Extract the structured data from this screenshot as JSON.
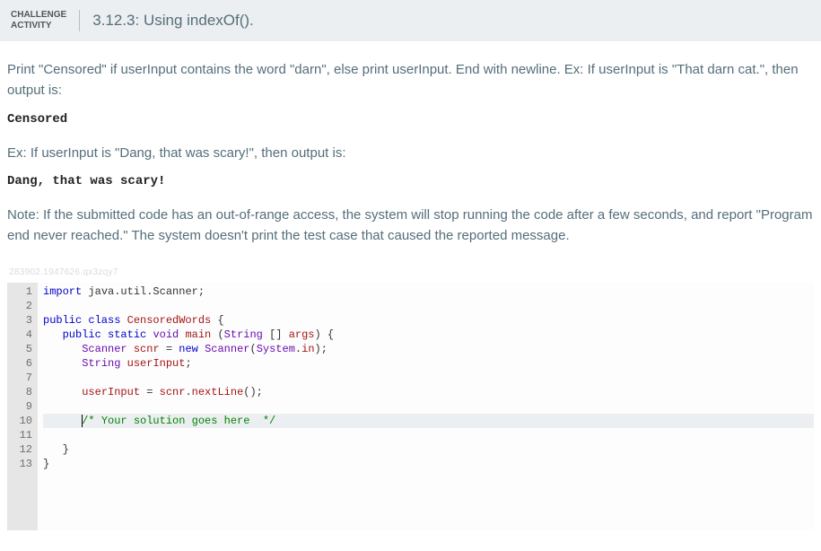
{
  "header": {
    "challenge_label_line1": "CHALLENGE",
    "challenge_label_line2": "ACTIVITY",
    "title": "3.12.3: Using indexOf()."
  },
  "description": {
    "p1": "Print \"Censored\" if userInput contains the word \"darn\", else print userInput. End with newline. Ex: If userInput is \"That darn cat.\", then output is:",
    "out1": "Censored",
    "p2": "Ex: If userInput is \"Dang, that was scary!\", then output is:",
    "out2": "Dang, that was scary!",
    "p3": "Note: If the submitted code has an out-of-range access, the system will stop running the code after a few seconds, and report \"Program end never reached.\" The system doesn't print the test case that caused the reported message."
  },
  "hash": "283902.1947626.qx3zqy7",
  "code": {
    "tokens": [
      [
        {
          "t": "import ",
          "c": "kw"
        },
        {
          "t": "java.util.Scanner;",
          "c": "pkg"
        }
      ],
      [],
      [
        {
          "t": "public class ",
          "c": "kw"
        },
        {
          "t": "CensoredWords",
          "c": "cls"
        },
        {
          "t": " {",
          "c": ""
        }
      ],
      [
        {
          "t": "   ",
          "c": ""
        },
        {
          "t": "public static ",
          "c": "kw"
        },
        {
          "t": "void",
          "c": "type"
        },
        {
          "t": " ",
          "c": ""
        },
        {
          "t": "main",
          "c": "cls"
        },
        {
          "t": " (",
          "c": ""
        },
        {
          "t": "String",
          "c": "type"
        },
        {
          "t": " [] ",
          "c": ""
        },
        {
          "t": "args",
          "c": "cls"
        },
        {
          "t": ") {",
          "c": ""
        }
      ],
      [
        {
          "t": "      ",
          "c": ""
        },
        {
          "t": "Scanner",
          "c": "type"
        },
        {
          "t": " ",
          "c": ""
        },
        {
          "t": "scnr",
          "c": "cls"
        },
        {
          "t": " = ",
          "c": ""
        },
        {
          "t": "new",
          "c": "kw"
        },
        {
          "t": " ",
          "c": ""
        },
        {
          "t": "Scanner",
          "c": "type"
        },
        {
          "t": "(",
          "c": ""
        },
        {
          "t": "System",
          "c": "type"
        },
        {
          "t": ".",
          "c": ""
        },
        {
          "t": "in",
          "c": "cls"
        },
        {
          "t": ");",
          "c": ""
        }
      ],
      [
        {
          "t": "      ",
          "c": ""
        },
        {
          "t": "String",
          "c": "type"
        },
        {
          "t": " ",
          "c": ""
        },
        {
          "t": "userInput",
          "c": "cls"
        },
        {
          "t": ";",
          "c": ""
        }
      ],
      [],
      [
        {
          "t": "      ",
          "c": ""
        },
        {
          "t": "userInput",
          "c": "cls"
        },
        {
          "t": " = ",
          "c": ""
        },
        {
          "t": "scnr",
          "c": "cls"
        },
        {
          "t": ".",
          "c": ""
        },
        {
          "t": "nextLine",
          "c": "cls"
        },
        {
          "t": "();",
          "c": ""
        }
      ],
      [],
      [
        {
          "t": "      ",
          "c": ""
        },
        {
          "t": "/* Your solution goes here  */",
          "c": "com"
        }
      ],
      [],
      [
        {
          "t": "   }",
          "c": ""
        }
      ],
      [
        {
          "t": "}",
          "c": ""
        }
      ]
    ],
    "highlight_index": 9
  }
}
